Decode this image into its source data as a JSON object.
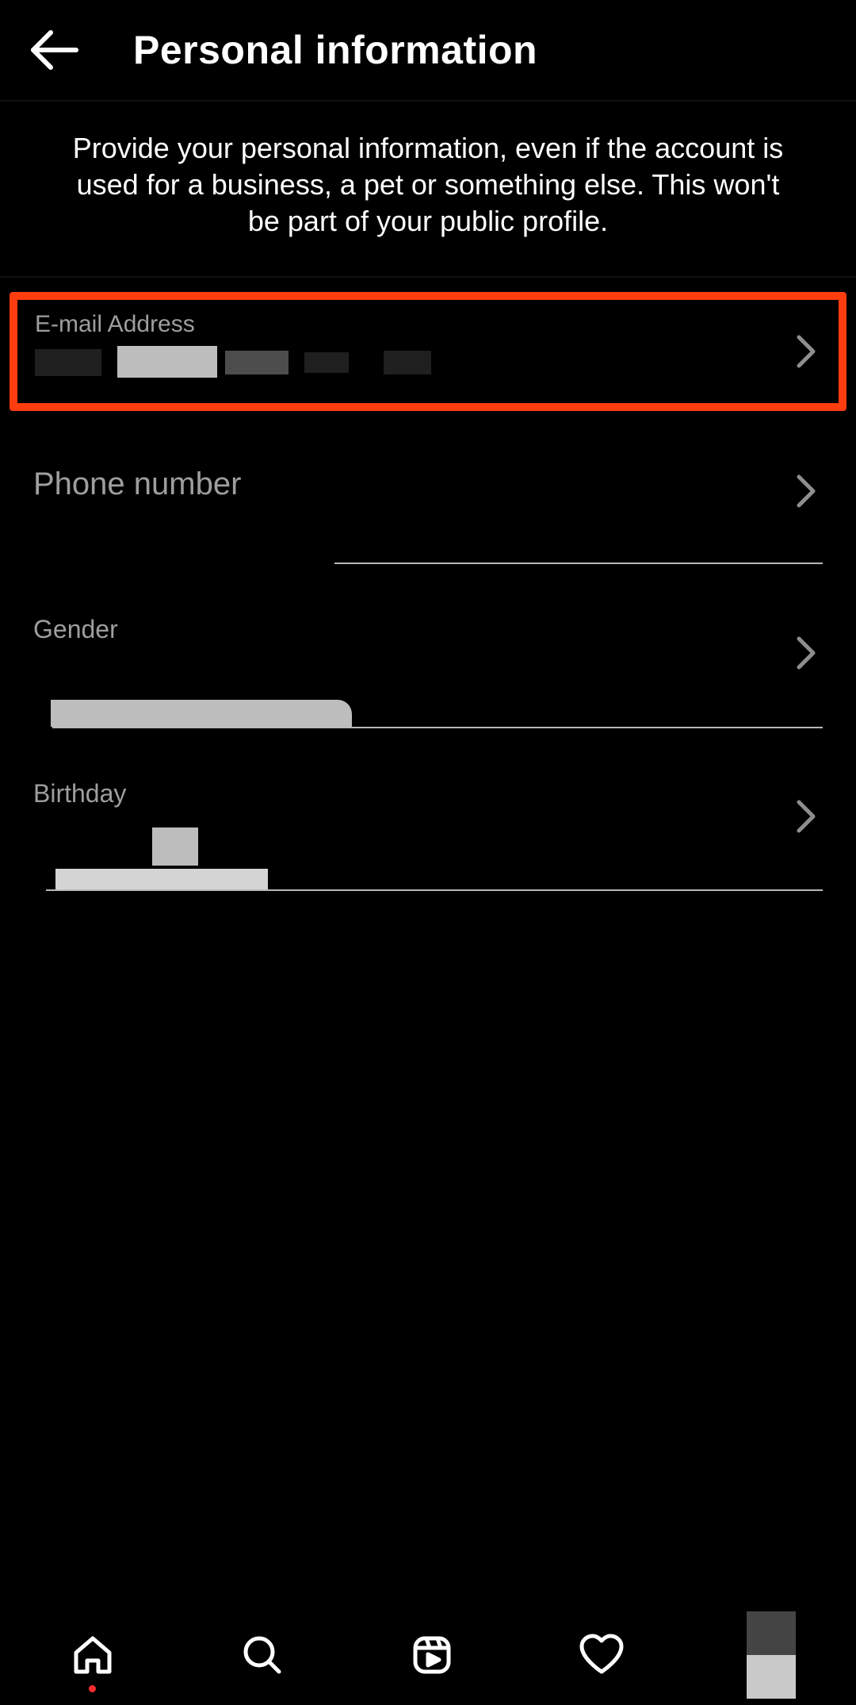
{
  "header": {
    "title": "Personal information"
  },
  "description": "Provide your personal information, even if the account is used for a business, a pet or something else. This won't be part of your public profile.",
  "fields": {
    "email": {
      "label": "E-mail Address"
    },
    "phone": {
      "label": "Phone number"
    },
    "gender": {
      "label": "Gender"
    },
    "birthday": {
      "label": "Birthday"
    }
  }
}
